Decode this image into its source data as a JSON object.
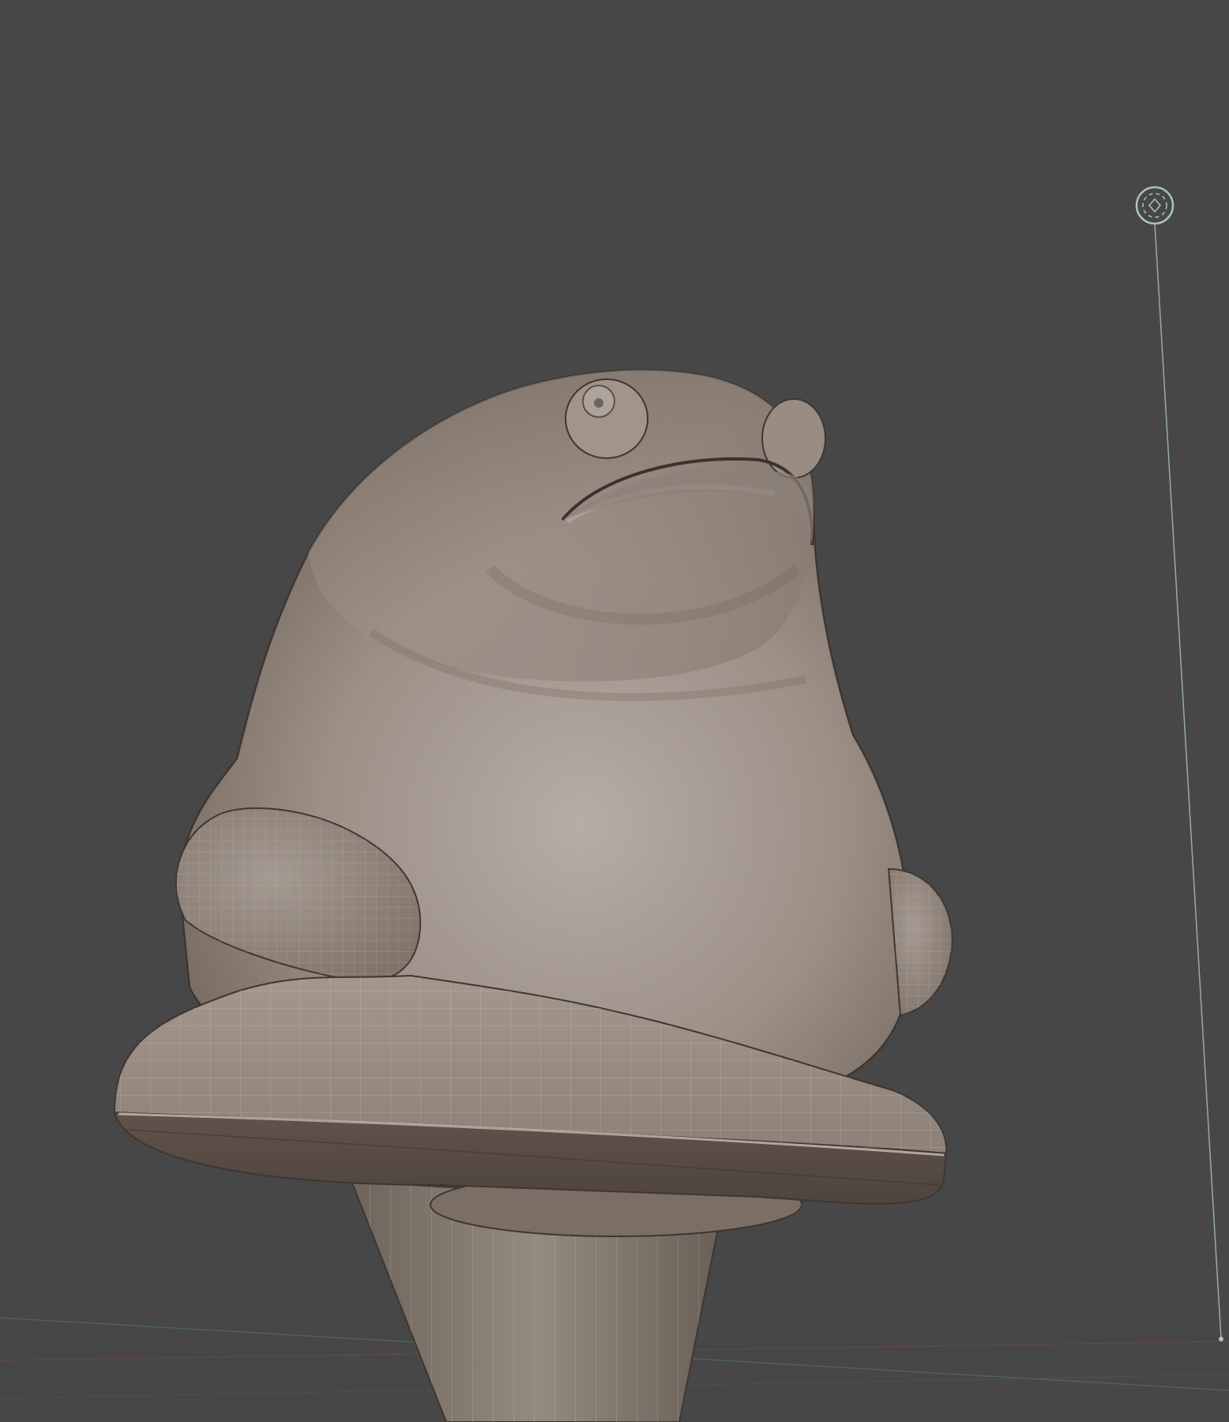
{
  "viewport": {
    "background_color": "#474747",
    "mode": "sculpt"
  },
  "scene": {
    "object_color": "#9a8e84",
    "object_shadow_color": "#6b5f56",
    "object_highlight_color": "#b8aea6",
    "wire_color": "#cfc6bf",
    "floor_axis_x_color": "#7a4a4a",
    "floor_axis_y_color": "#4f7a5a",
    "light_widget_color": "#a9c4c2"
  },
  "icons": {
    "light": "light-gizmo-icon"
  }
}
